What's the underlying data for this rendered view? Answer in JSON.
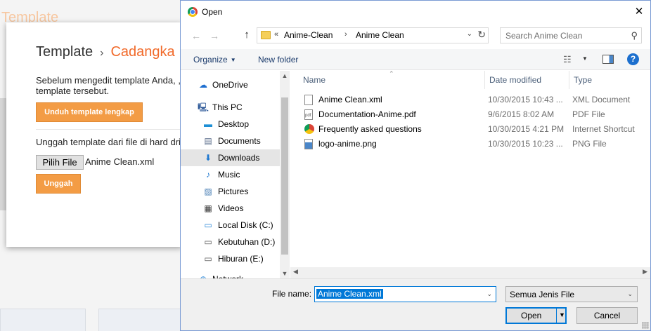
{
  "background_page": {
    "header_text": "Template",
    "title": "Template",
    "title_separator": "›",
    "title_sub": "Cadangka",
    "description": "Sebelum mengedit template Anda, , template tersebut.",
    "download_button": "Unduh template lengkap",
    "upload_label": "Unggah template dari file di hard dri",
    "pick_file_button": "Pilih File",
    "picked_file": "Anime Clean.xml",
    "upload_button": "Unggah"
  },
  "dialog": {
    "title": "Open",
    "close_glyph": "✕",
    "nav": {
      "back": "←",
      "forward": "→",
      "up": "↑"
    },
    "address": {
      "chevron": "«",
      "crumbs": [
        "Anime-Clean",
        "Anime Clean"
      ],
      "separator": "›",
      "dropdown": "⌄",
      "refresh": "↻"
    },
    "search": {
      "placeholder": "Search Anime Clean",
      "icon": "⚲"
    },
    "toolbar": {
      "organize": "Organize",
      "organize_caret": "▼",
      "new_folder": "New folder",
      "view_icon": "☷",
      "view_caret": "▼",
      "help": "?"
    },
    "nav_pane": {
      "items": [
        {
          "label": "OneDrive",
          "icon": "cloud-icon",
          "glyph": "☁",
          "color": "#1e6fd0",
          "indent": 0,
          "state": ""
        },
        {
          "label": "This PC",
          "icon": "computer-icon",
          "glyph": "🖳",
          "color": "#2b5797",
          "indent": 0,
          "state": ""
        },
        {
          "label": "Desktop",
          "icon": "desktop-icon",
          "glyph": "▬",
          "color": "#1e8fd5",
          "indent": 1,
          "state": ""
        },
        {
          "label": "Documents",
          "icon": "documents-icon",
          "glyph": "▤",
          "color": "#5a6c8a",
          "indent": 1,
          "state": ""
        },
        {
          "label": "Downloads",
          "icon": "downloads-icon",
          "glyph": "⬇",
          "color": "#1e78d0",
          "indent": 1,
          "state": "hover"
        },
        {
          "label": "Music",
          "icon": "music-icon",
          "glyph": "♪",
          "color": "#1e78d0",
          "indent": 1,
          "state": ""
        },
        {
          "label": "Pictures",
          "icon": "pictures-icon",
          "glyph": "▨",
          "color": "#4a7fb5",
          "indent": 1,
          "state": ""
        },
        {
          "label": "Videos",
          "icon": "videos-icon",
          "glyph": "▦",
          "color": "#333333",
          "indent": 1,
          "state": ""
        },
        {
          "label": "Local Disk (C:)",
          "icon": "local-disk-icon",
          "glyph": "▭",
          "color": "#2d89d8",
          "indent": 1,
          "state": ""
        },
        {
          "label": "Kebutuhan (D:)",
          "icon": "drive-icon",
          "glyph": "▭",
          "color": "#555555",
          "indent": 1,
          "state": ""
        },
        {
          "label": "Hiburan (E:)",
          "icon": "drive-icon",
          "glyph": "▭",
          "color": "#555555",
          "indent": 1,
          "state": ""
        },
        {
          "label": "Network",
          "icon": "network-icon",
          "glyph": "⊕",
          "color": "#2d89d8",
          "indent": 0,
          "state": ""
        }
      ],
      "scroll_up": "▲",
      "scroll_down": "▼"
    },
    "columns": [
      "Name",
      "Date modified",
      "Type"
    ],
    "sort_indicator": "⌃",
    "files": [
      {
        "name": "Anime Clean.xml",
        "date": "10/30/2015 10:43 ...",
        "type": "XML Document",
        "icon": "xml-file-icon",
        "kind": "doc"
      },
      {
        "name": "Documentation-Anime.pdf",
        "date": "9/6/2015 8:02 AM",
        "type": "PDF File",
        "icon": "pdf-file-icon",
        "kind": "pdf"
      },
      {
        "name": "Frequently asked questions",
        "date": "10/30/2015 4:21 PM",
        "type": "Internet Shortcut",
        "icon": "chrome-shortcut-icon",
        "kind": "web"
      },
      {
        "name": "logo-anime.png",
        "date": "10/30/2015 10:23 ...",
        "type": "PNG File",
        "icon": "png-file-icon",
        "kind": "png"
      }
    ],
    "h_scroll": {
      "left": "◀",
      "right": "▶"
    },
    "file_name_label": "File name:",
    "file_name_value": "Anime Clean.xml",
    "file_name_caret": "⌄",
    "file_type_value": "Semua Jenis File",
    "file_type_caret": "⌄",
    "open_button": "Open",
    "open_caret": "▼",
    "cancel_button": "Cancel"
  }
}
